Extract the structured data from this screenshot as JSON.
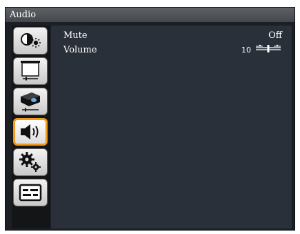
{
  "window": {
    "title": "Audio"
  },
  "sidebar": {
    "tabs": [
      {
        "name": "tab-image",
        "icon": "brightness-contrast-icon",
        "active": false
      },
      {
        "name": "tab-display",
        "icon": "screen-icon",
        "active": false
      },
      {
        "name": "tab-setup",
        "icon": "projector-icon",
        "active": false
      },
      {
        "name": "tab-audio",
        "icon": "speaker-icon",
        "active": true
      },
      {
        "name": "tab-settings",
        "icon": "gears-icon",
        "active": false
      },
      {
        "name": "tab-info",
        "icon": "info-panel-icon",
        "active": false
      }
    ]
  },
  "menu": {
    "mute": {
      "label": "Mute",
      "value": "Off"
    },
    "volume": {
      "label": "Volume",
      "value": "10",
      "level_fraction": 0.5
    }
  },
  "colors": {
    "accent": "#f29a1a",
    "panel": "#2a3039",
    "sidebar": "#131517"
  }
}
